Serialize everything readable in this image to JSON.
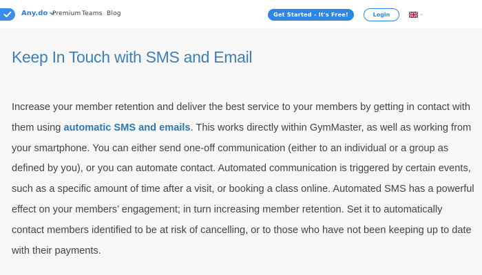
{
  "header": {
    "brand": "Any.do",
    "nav": [
      "Premium",
      "Teams",
      "Blog"
    ],
    "cta_label": "Get Started - It's Free!",
    "login_label": "Login"
  },
  "icons": {
    "logo": "checkmark-icon",
    "brand_dropdown": "chevron-down-icon",
    "language": "uk-flag-icon"
  },
  "colors": {
    "accent": "#2c86e6",
    "title": "#3d7fb6",
    "link": "#2a7ab8",
    "text": "#444444",
    "background": "#f7f7f7"
  },
  "article": {
    "title": "Keep In Touch with SMS and Email",
    "paragraph_before": "Increase your member retention and deliver the best service to your members by getting in contact with them using ",
    "link_text": "automatic SMS and emails",
    "paragraph_after": ". This works directly within GymMaster, as well as working from your smartphone. You can either send one-off communication (either to an individual or a group as defined by you), or you can automate contact. Automated communication is triggered by certain events, such as a specific amount of time after a visit, or booking a class online. Automated SMS has a powerful effect on your members’ engagement; in turn increasing member retention. Set it to automatically contact members identified to be at risk of cancelling, or to those who have not been keeping up to date with their payments."
  }
}
